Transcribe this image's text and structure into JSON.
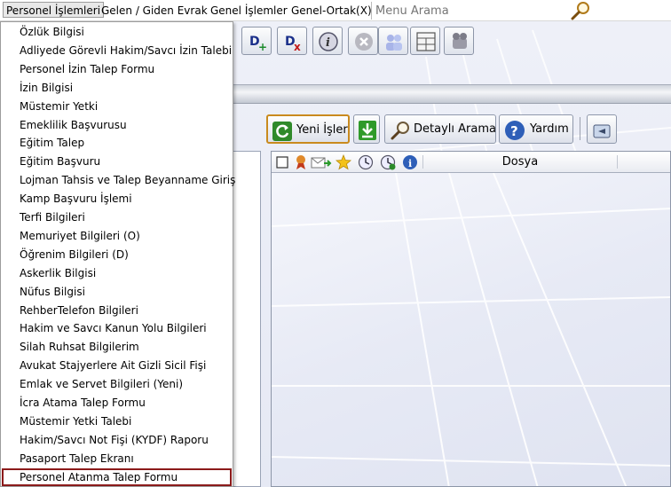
{
  "menubar": {
    "items": [
      {
        "label": "Personel İşlemleri"
      },
      {
        "label": "Gelen / Giden Evrak"
      },
      {
        "label": "Genel İşlemler"
      },
      {
        "label": "Genel-Ortak(X)"
      }
    ],
    "search_placeholder": "Menu Arama"
  },
  "dropdown": {
    "items": [
      "Özlük Bilgisi",
      "Adliyede Görevli Hakim/Savcı İzin Talebi",
      "Personel İzin Talep Formu",
      "İzin Bilgisi",
      "Müstemir Yetki",
      "Emeklilik Başvurusu",
      "Eğitim Talep",
      "Eğitim Başvuru",
      "Lojman Tahsis ve Talep Beyanname Giriş",
      "Kamp Başvuru İşlemi",
      "Terfi Bilgileri",
      "Memuriyet Bilgileri (O)",
      "Öğrenim Bilgileri (D)",
      "Askerlik Bilgisi",
      "Nüfus Bilgisi",
      "RehberTelefon Bilgileri",
      "Hakim ve Savcı Kanun Yolu Bilgileri",
      "Silah Ruhsat Bilgilerim",
      "Avukat Stajyerlere Ait Gizli Sicil Fişi",
      "Emlak ve Servet Bilgileri (Yeni)",
      "İcra Atama Talep Formu",
      "Müstemir Yetki Talebi",
      "Hakim/Savcı Not Fişi (KYDF) Raporu",
      "Pasaport Talep Ekranı",
      "Personel Atanma Talep Formu"
    ],
    "highlighted_index": 24
  },
  "toolbar2": {
    "yeni_label": "Yeni İşler",
    "detay_label": "Detaylı Arama",
    "yardim_label": "Yardım"
  },
  "grid": {
    "column_dosya": "Dosya"
  },
  "colors": {
    "highlight_border": "#8b1a1a",
    "yeni_border": "#c98a1e"
  }
}
